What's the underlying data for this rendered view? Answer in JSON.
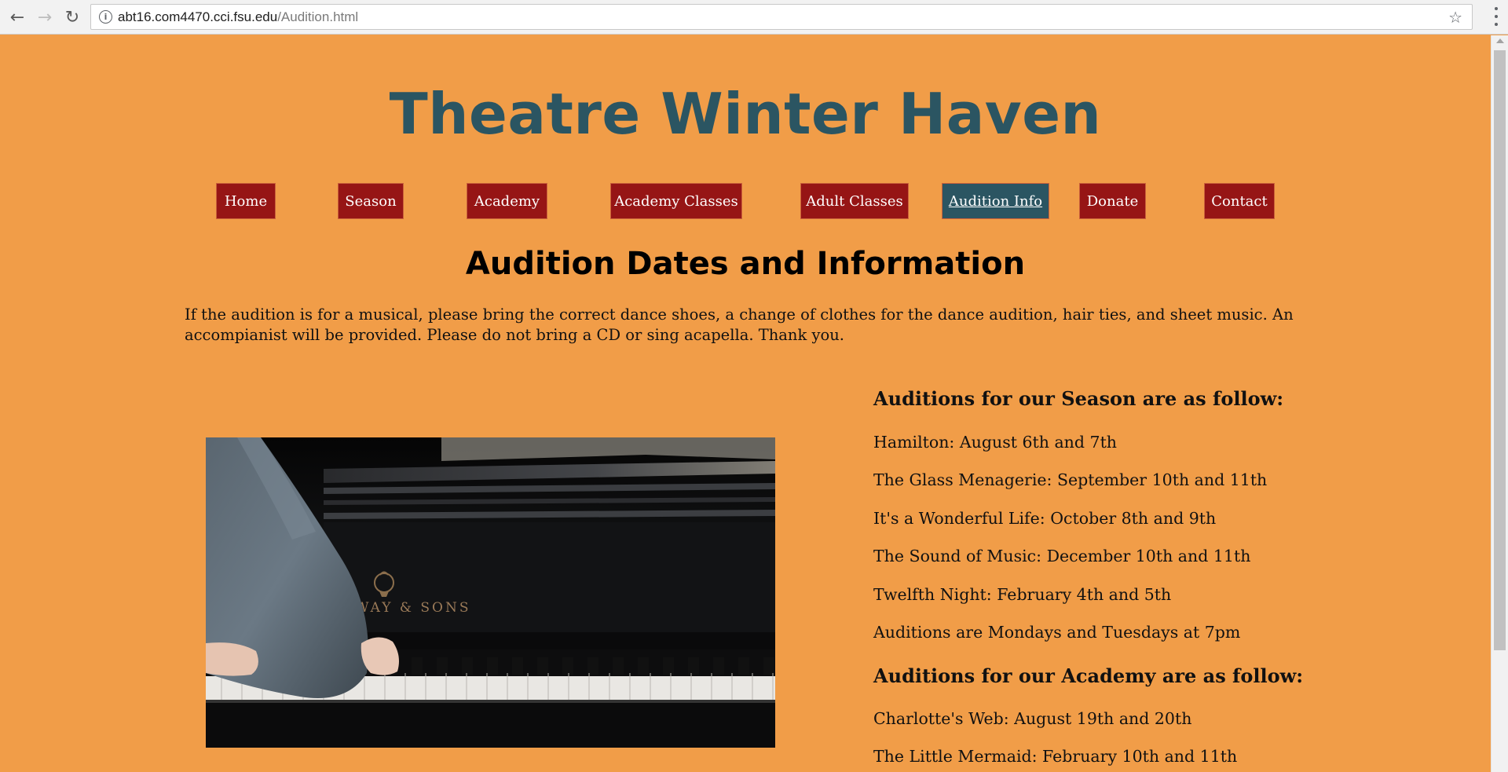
{
  "browser": {
    "url_host": "abt16.com4470.cci.fsu.edu",
    "url_path": "/Audition.html"
  },
  "site_title": "Theatre Winter Haven",
  "nav": [
    {
      "label": "Home"
    },
    {
      "label": "Season"
    },
    {
      "label": "Academy"
    },
    {
      "label": "Academy Classes"
    },
    {
      "label": "Adult Classes"
    },
    {
      "label": "Audition Info",
      "active": true
    },
    {
      "label": "Donate"
    },
    {
      "label": "Contact"
    }
  ],
  "heading": "Audition Dates and Information",
  "intro": "If the audition is for a musical, please bring the correct dance shoes, a change of clothes for the dance audition, hair ties, and sheet music. An accompianist will be provided. Please do not bring a CD or sing acapella. Thank you.",
  "image": {
    "subject": "pianist's hands on a grand piano keyboard",
    "brand_text": "WAY & SONS"
  },
  "season": {
    "heading": "Auditions for our Season are as follow:",
    "items": [
      "Hamilton: August 6th and 7th",
      "The Glass Menagerie: September 10th and 11th",
      "It's a Wonderful Life: October 8th and 9th",
      "The Sound of Music: December 10th and 11th",
      "Twelfth Night: February 4th and 5th",
      "Auditions are Mondays and Tuesdays at 7pm"
    ]
  },
  "academy": {
    "heading": "Auditions for our Academy are as follow:",
    "items": [
      "Charlotte's Web: August 19th and 20th",
      "The Little Mermaid: February 10th and 11th"
    ]
  },
  "colors": {
    "page_bg": "#f19d48",
    "title": "#2b5562",
    "nav_bg": "#961515",
    "nav_active_bg": "#2b5562"
  }
}
